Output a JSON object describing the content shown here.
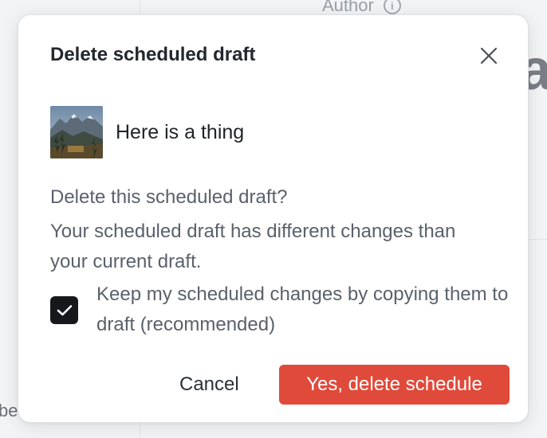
{
  "background": {
    "author_label": "Author",
    "big_letter": "a",
    "fragment_text": "be"
  },
  "modal": {
    "title": "Delete scheduled draft",
    "item": {
      "title": "Here is a thing",
      "thumbnail_icon": "mountain-landscape-image"
    },
    "question": "Delete this scheduled draft?",
    "description": "Your scheduled draft has different changes than your current draft.",
    "checkbox": {
      "checked": true,
      "label": "Keep my scheduled changes by copying them to draft (recommended)"
    },
    "actions": {
      "cancel_label": "Cancel",
      "confirm_label": "Yes, delete schedule"
    }
  },
  "colors": {
    "danger": "#e04a3a",
    "checkbox_fill": "#16181c",
    "text_primary": "#23272e",
    "text_secondary": "#5a616b"
  }
}
